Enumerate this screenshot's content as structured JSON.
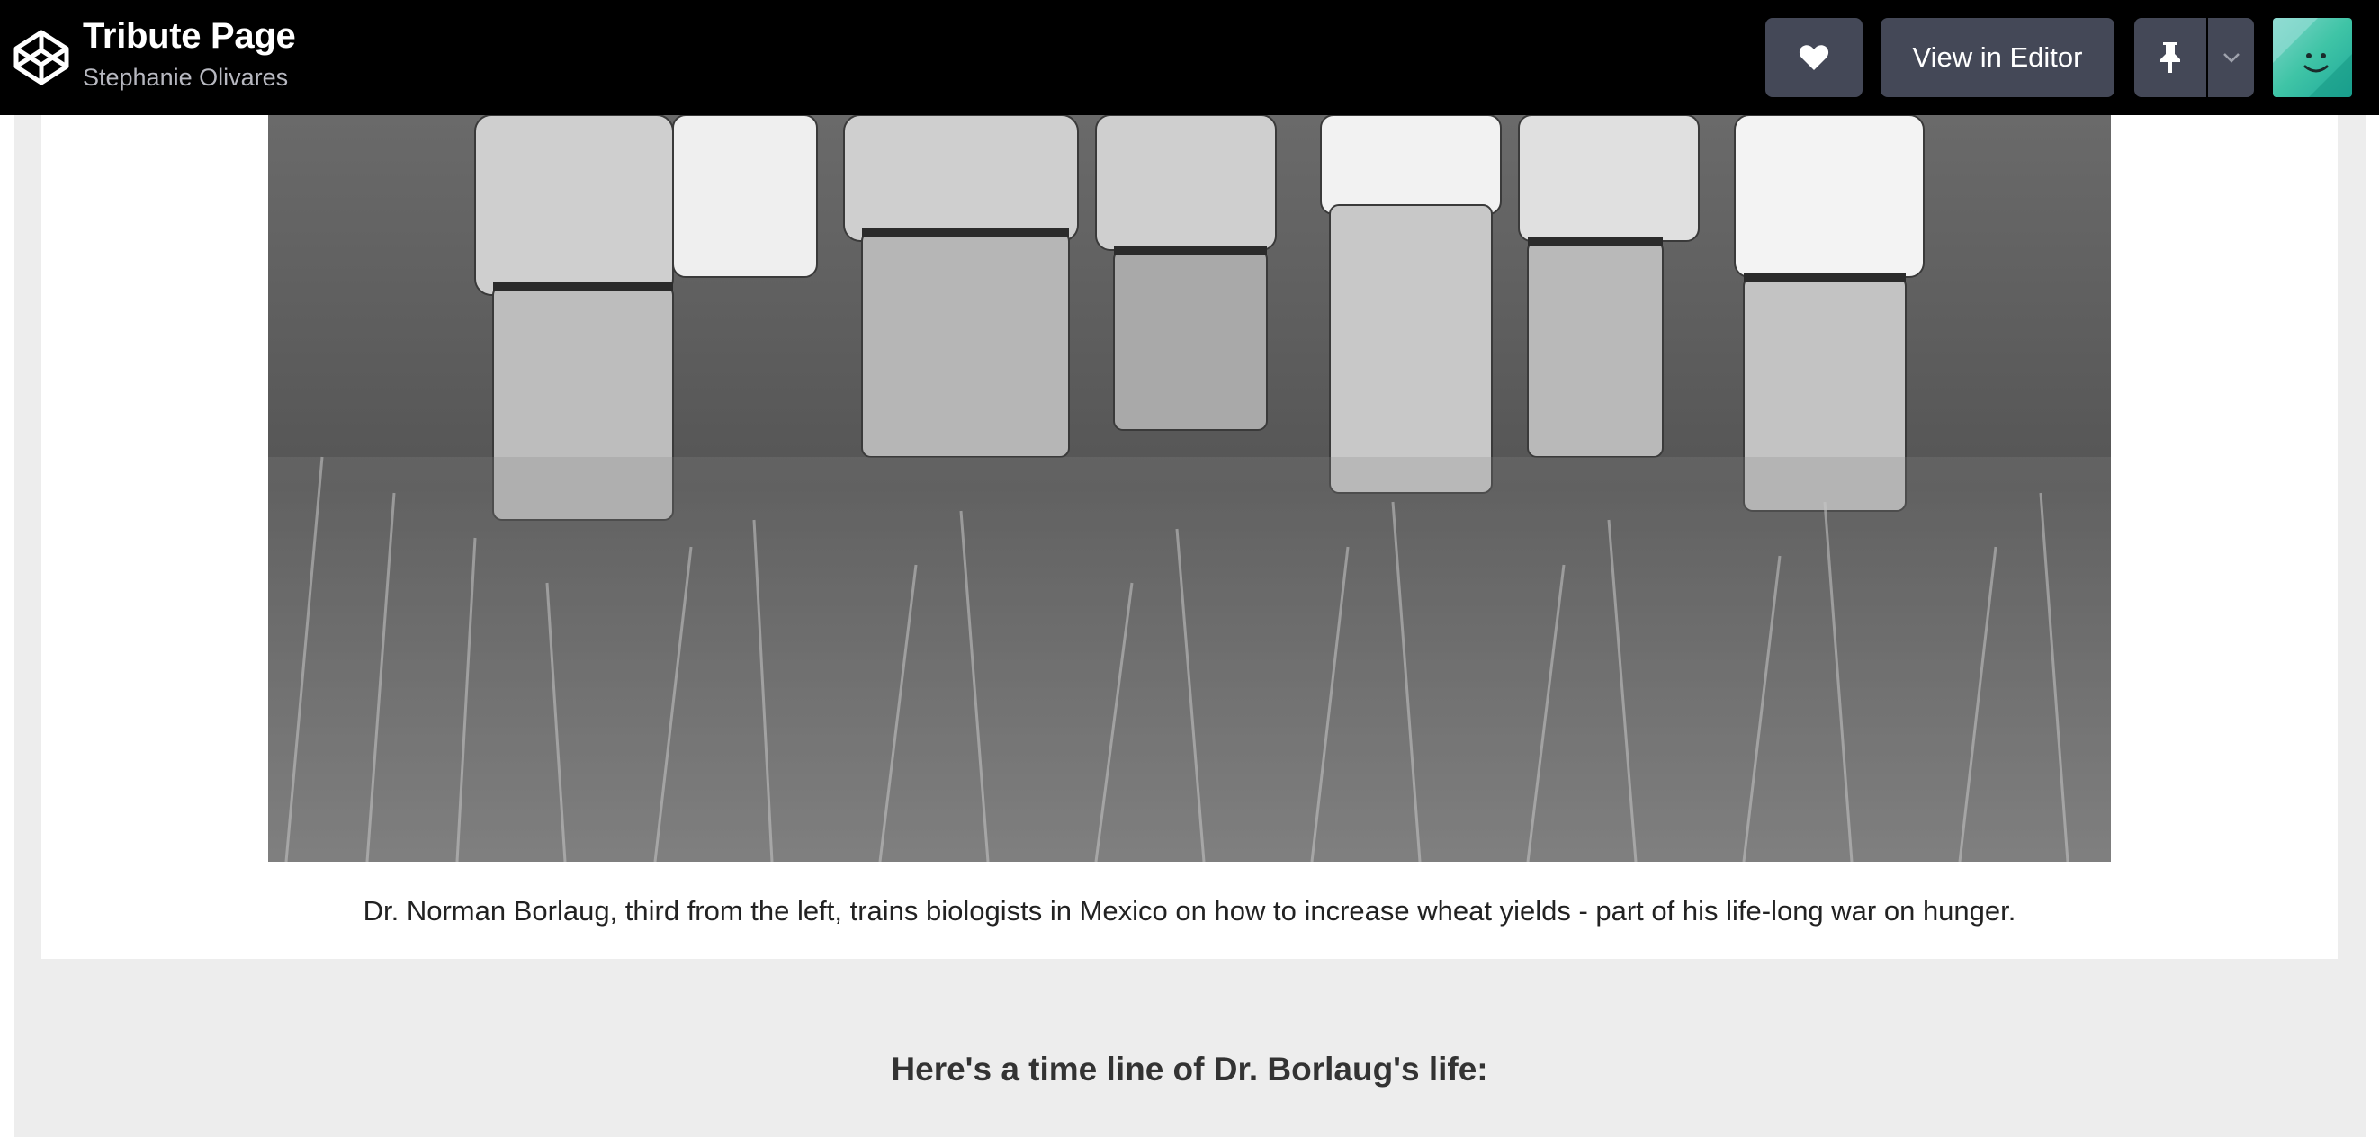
{
  "header": {
    "title": "Tribute Page",
    "author": "Stephanie Olivares",
    "buttons": {
      "like_icon": "heart-icon",
      "view_in_editor": "View in Editor",
      "pin_icon": "pin-icon",
      "dropdown_icon": "chevron-down-icon"
    }
  },
  "figure": {
    "image_alt": "Dr. Norman Borlaug training biologists in a wheat field",
    "caption": "Dr. Norman Borlaug, third from the left, trains biologists in Mexico on how to increase wheat yields - part of his life-long war on hunger."
  },
  "timeline": {
    "heading": "Here's a time line of Dr. Borlaug's life:"
  },
  "colors": {
    "topbar": "#000000",
    "button": "#444857",
    "page_background": "#ededed",
    "card": "#ffffff"
  }
}
